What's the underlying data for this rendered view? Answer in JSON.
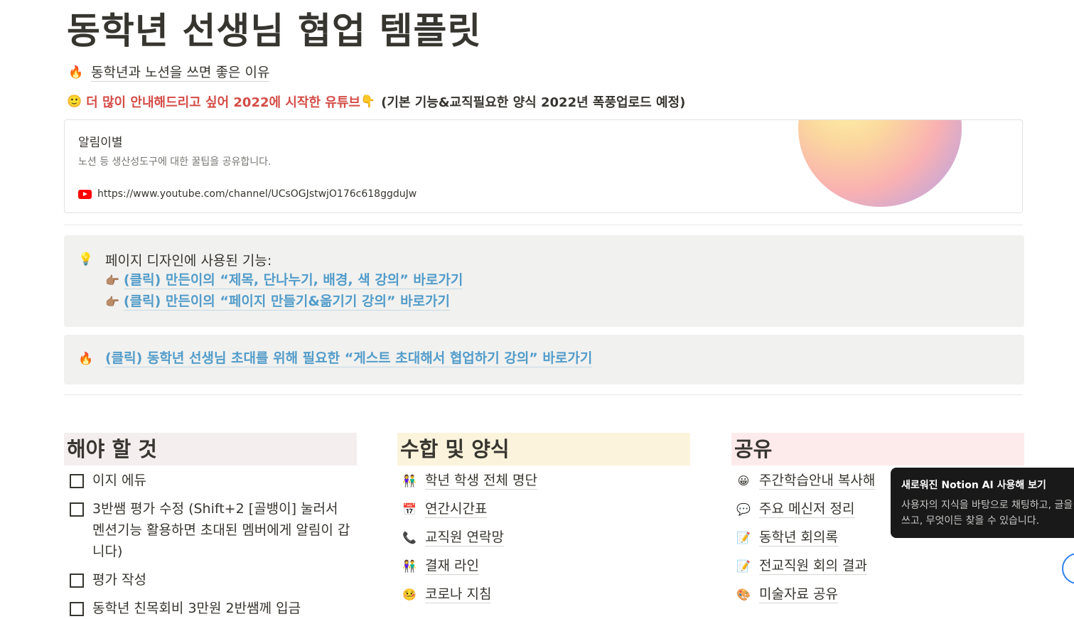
{
  "page": {
    "title": "동학년 선생님 협업 템플릿"
  },
  "subpage": {
    "icon": "🔥",
    "label": "동학년과 노션을 쓰면 좋은 이유"
  },
  "youtube_line": {
    "smile": "🙂",
    "red_text": "더 많이 안내해드리고 싶어 2022에 시작한 유튜브",
    "point": "👇",
    "dark_text": "(기본 기능&교직필요한 양식 2022년 폭풍업로드 예정)"
  },
  "bookmark": {
    "title": "알림이별",
    "description": "노션 등 생산성도구에 대한 꿀팁을 공유합니다.",
    "url": "https://www.youtube.com/channel/UCsOGJstwjO176c618ggduJw"
  },
  "callout1": {
    "icon": "💡",
    "text": "페이지 디자인에 사용된 기능:",
    "links": [
      {
        "hand": "👉🏽",
        "label": "(클릭) 만든이의 “제목, 단나누기, 배경, 색 강의” 바로가기"
      },
      {
        "hand": "👉🏽",
        "label": "(클릭) 만든이의 “페이지 만들기&옮기기 강의” 바로가기"
      }
    ]
  },
  "callout2": {
    "icon": "🔥",
    "link": "(클릭) 동학년 선생님 초대를 위해 필요한 “게스트 초대해서 협업하기 강의” 바로가기"
  },
  "columns": {
    "todo": {
      "heading": "해야 할 것",
      "items": [
        {
          "text": "이지 에듀",
          "checked": false
        },
        {
          "text": "3반쌤 평가 수정 (Shift+2 [골뱅이] 눌러서 멘션기능 활용하면 초대된 멤버에게 알림이 갑니다)",
          "checked": false
        },
        {
          "text": "평가 작성",
          "checked": false
        },
        {
          "text": "동학년 친목회비 3만원 2반쌤께 입금",
          "checked": false
        }
      ]
    },
    "forms": {
      "heading": "수합 및 양식",
      "items": [
        {
          "icon": "👫",
          "label": "학년 학생 전체 명단"
        },
        {
          "icon": "📅",
          "label": "연간시간표"
        },
        {
          "icon": "📞",
          "label": "교직원 연락망"
        },
        {
          "icon": "👫",
          "label": "결재 라인"
        },
        {
          "icon": "🤒",
          "label": "코로나 지침"
        }
      ]
    },
    "share": {
      "heading": "공유",
      "items": [
        {
          "icon": "😀",
          "label": "주간학습안내 복사해"
        },
        {
          "icon": "💬",
          "label": "주요 메신저 정리"
        },
        {
          "icon": "📝",
          "label": "동학년 회의록"
        },
        {
          "icon": "📝",
          "label": "전교직원 회의 결과"
        },
        {
          "icon": "🎨",
          "label": "미술자료 공유"
        }
      ]
    }
  },
  "tooltip": {
    "title": "새로워진 Notion AI 사용해 보기",
    "body": "사용자의 지식을 바탕으로 채팅하고, 글을 쓰고, 무엇이든 찾을 수 있습니다."
  },
  "colors": {
    "todo_header_bg": "#f4eeee",
    "forms_header_bg": "#fbf3db",
    "share_header_bg": "#fdebec",
    "link_blue": "#529cca",
    "red_text": "#d44c47"
  }
}
